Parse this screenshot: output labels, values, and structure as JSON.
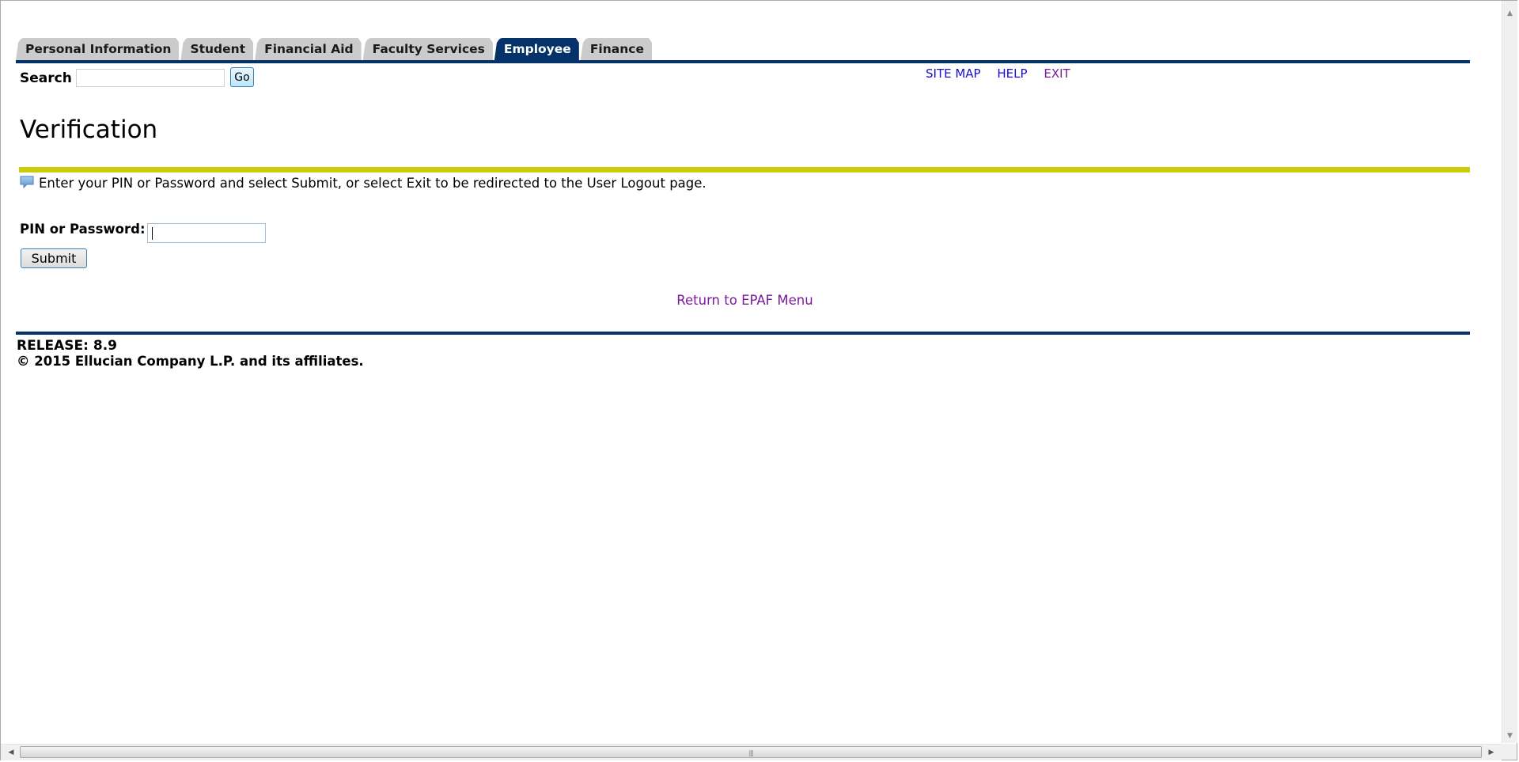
{
  "tabs": [
    {
      "label": "Personal Information",
      "active": false
    },
    {
      "label": "Student",
      "active": false
    },
    {
      "label": "Financial Aid",
      "active": false
    },
    {
      "label": "Faculty Services",
      "active": false
    },
    {
      "label": "Employee",
      "active": true
    },
    {
      "label": "Finance",
      "active": false
    }
  ],
  "search": {
    "label": "Search",
    "value": "",
    "placeholder": "",
    "go_label": "Go"
  },
  "top_links": {
    "site_map": "SITE MAP",
    "help": "HELP",
    "exit": "EXIT"
  },
  "page": {
    "title": "Verification",
    "info_icon": "speech-bubble-icon",
    "info_text": "Enter your PIN or Password and select Submit, or select Exit to be redirected to the User Logout page."
  },
  "form": {
    "pin_label": "PIN or Password:",
    "pin_value": "",
    "submit_label": "Submit"
  },
  "return_link": "Return to EPAF Menu",
  "footer": {
    "release": "RELEASE: 8.9",
    "copyright": "© 2015 Ellucian Company L.P. and its affiliates."
  },
  "colors": {
    "nav_blue": "#06326a",
    "accent_bar": "#c8cc09",
    "link": "#1a0dcc",
    "visited_link": "#7a1b9c"
  }
}
